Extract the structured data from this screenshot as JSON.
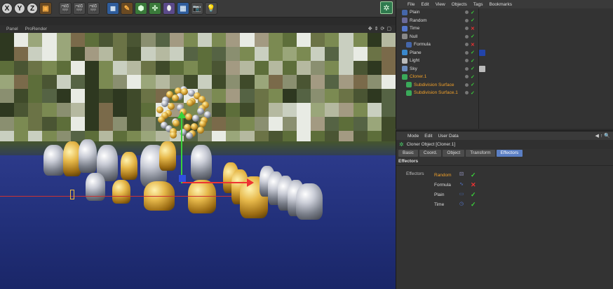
{
  "toolbar": {
    "axis_buttons": [
      "X",
      "Y",
      "Z"
    ],
    "icons": [
      "coordinate-system-icon",
      "render-view-icon",
      "render-picture-queue-icon",
      "render-settings-icon",
      "cube-icon",
      "pen-icon",
      "subdivision-icon",
      "array-icon",
      "deformer-icon",
      "floor-icon",
      "camera-icon",
      "light-icon"
    ]
  },
  "viewport": {
    "menu": [
      "Panel",
      "ProRender"
    ]
  },
  "object_manager": {
    "menu": [
      "File",
      "Edit",
      "View",
      "Objects",
      "Tags",
      "Bookmarks"
    ],
    "rows": [
      {
        "label": "Plain",
        "status": "check",
        "indent": 0
      },
      {
        "label": "Random",
        "status": "check",
        "indent": 0
      },
      {
        "label": "Time",
        "status": "x",
        "indent": 0
      },
      {
        "label": "Null",
        "status": "check",
        "indent": 0
      },
      {
        "label": "Formula",
        "status": "x",
        "indent": 1
      },
      {
        "label": "Plane",
        "status": "check",
        "indent": 0
      },
      {
        "label": "Light",
        "status": "check",
        "indent": 0
      },
      {
        "label": "Sky",
        "status": "check",
        "indent": 0
      },
      {
        "label": "Cloner.1",
        "status": "check",
        "indent": 0,
        "highlight": true
      },
      {
        "label": "Subdivision Surface",
        "status": "check",
        "indent": 1,
        "highlight": true
      },
      {
        "label": "Subdivision Surface.1",
        "status": "check",
        "indent": 1,
        "highlight": true
      }
    ]
  },
  "attribute_manager": {
    "menu": [
      "Mode",
      "Edit",
      "User Data"
    ],
    "title": "Cloner Object [Cloner.1]",
    "tabs": [
      "Basic",
      "Coord.",
      "Object",
      "Transform",
      "Effectors"
    ],
    "active_tab": "Effectors",
    "section": "Effectors",
    "field_label": "Effectors",
    "effectors": [
      {
        "name": "Random",
        "enabled": true,
        "active": true
      },
      {
        "name": "Formula",
        "enabled": false,
        "active": false
      },
      {
        "name": "Plain",
        "enabled": true,
        "active": false
      },
      {
        "name": "Time",
        "enabled": true,
        "active": false
      }
    ]
  },
  "colors": {
    "accent": "#5b7fc4",
    "active_text": "#f0a02a",
    "check": "#3ad13a",
    "cross": "#e33333"
  }
}
